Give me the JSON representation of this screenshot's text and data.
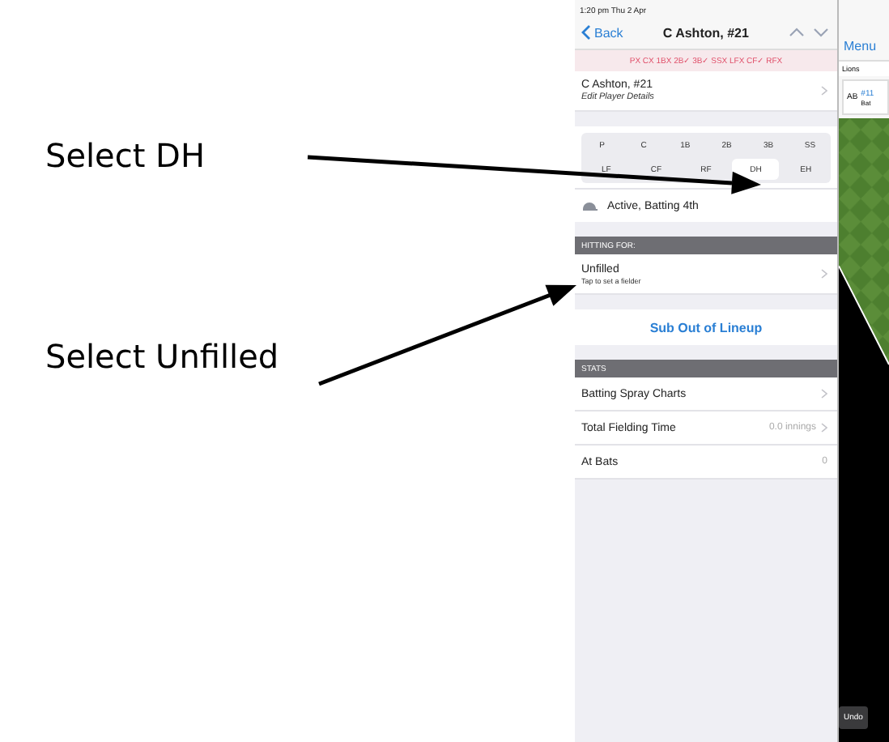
{
  "annotations": [
    {
      "text": "Select DH"
    },
    {
      "text": "Select Unfilled"
    }
  ],
  "status_bar": {
    "time": "1:20 pm  Thu 2 Apr"
  },
  "nav": {
    "back": "Back",
    "title": "C Ashton, #21"
  },
  "position_status": "PX CX 1BX 2B✓ 3B✓ SSX LFX CF✓ RFX",
  "player": {
    "name": "C Ashton, #21",
    "subtitle": "Edit Player Details"
  },
  "positions": [
    [
      {
        "label": "P",
        "selected": false
      },
      {
        "label": "C",
        "selected": false
      },
      {
        "label": "1B",
        "selected": false
      },
      {
        "label": "2B",
        "selected": false
      },
      {
        "label": "3B",
        "selected": false
      },
      {
        "label": "SS",
        "selected": false
      }
    ],
    [
      {
        "label": "LF",
        "selected": false
      },
      {
        "label": "CF",
        "selected": false
      },
      {
        "label": "RF",
        "selected": false
      },
      {
        "label": "DH",
        "selected": true
      },
      {
        "label": "EH",
        "selected": false
      }
    ]
  ],
  "status_row": {
    "text": "Active, Batting 4th"
  },
  "hitting_for": {
    "header": "HITTING FOR:",
    "title": "Unfilled",
    "subtitle": "Tap to set a fielder"
  },
  "sub_button": "Sub Out of Lineup",
  "stats": {
    "header": "STATS",
    "rows": [
      {
        "label": "Batting Spray Charts",
        "value": "",
        "disclosure": true
      },
      {
        "label": "Total Fielding Time",
        "value": "0.0 innings",
        "disclosure": true
      },
      {
        "label": "At Bats",
        "value": "0",
        "disclosure": false
      }
    ]
  },
  "side": {
    "menu": "Menu",
    "team": "Lions",
    "batter_tag": "AB",
    "batter_number": "#11",
    "batter_line": "Bat",
    "undo": "Undo"
  }
}
